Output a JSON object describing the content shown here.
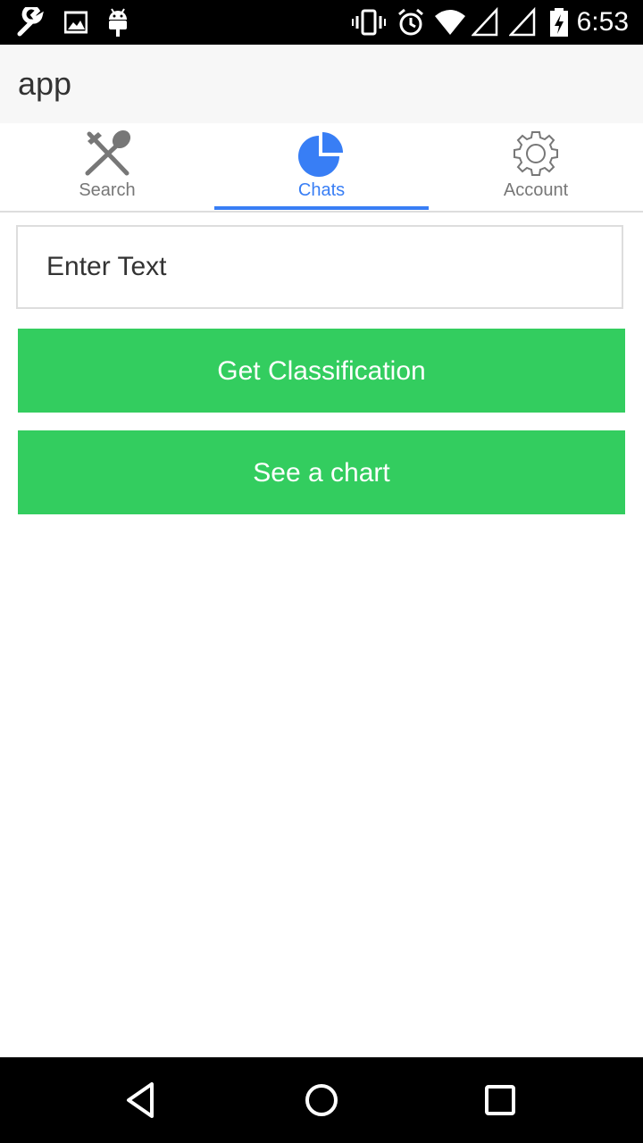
{
  "status_bar": {
    "time": "6:53",
    "left_icons": [
      "wrench-icon",
      "image-icon",
      "android-icon"
    ],
    "right_icons": [
      "vibrate-icon",
      "alarm-icon",
      "wifi-icon",
      "signal-icon",
      "signal-icon",
      "battery-charging-icon"
    ]
  },
  "app_bar": {
    "title": "app"
  },
  "tabs": [
    {
      "label": "Search",
      "icon": "fork-spoon-icon",
      "active": false
    },
    {
      "label": "Chats",
      "icon": "pie-chart-icon",
      "active": true
    },
    {
      "label": "Account",
      "icon": "gear-icon",
      "active": false
    }
  ],
  "form": {
    "input_placeholder": "Enter Text",
    "input_value": ""
  },
  "buttons": {
    "classify_label": "Get Classification",
    "chart_label": "See a chart"
  },
  "nav_bar": {
    "icons": [
      "back-icon",
      "home-icon",
      "recents-icon"
    ]
  },
  "colors": {
    "accent": "#387ef5",
    "button_green": "#33cd5f",
    "status_bar": "#000000",
    "app_bar": "#f7f7f7"
  }
}
